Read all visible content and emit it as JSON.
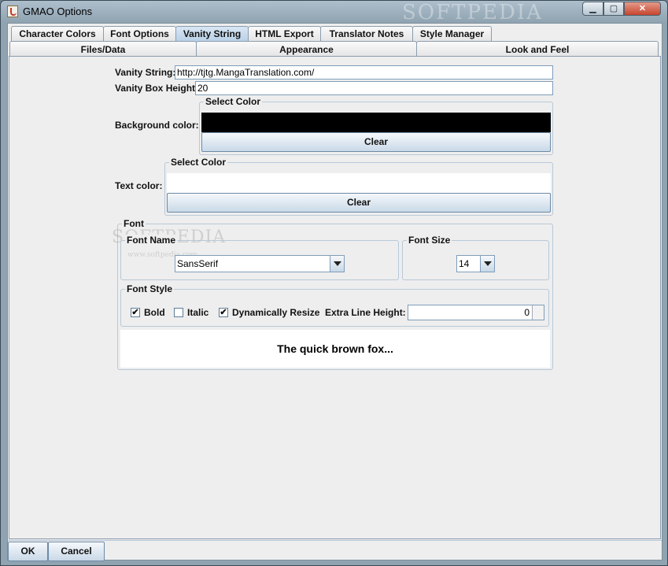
{
  "window": {
    "title": "GMAO Options",
    "watermark": "SOFTPEDIA"
  },
  "window_buttons": {
    "minimize": "▁",
    "maximize": "▢",
    "close": "✕"
  },
  "tabs_row1": [
    "Character Colors",
    "Font Options",
    "Vanity String",
    "HTML Export",
    "Translator Notes",
    "Style Manager"
  ],
  "tabs_row2": [
    "Files/Data",
    "Appearance",
    "Look and Feel"
  ],
  "vanity": {
    "string_label": "Vanity String:",
    "string_value": "http://tjtg.MangaTranslation.com/",
    "height_label": "Vanity Box Height:",
    "height_value": "20"
  },
  "background_color": {
    "label": "Background color:",
    "group_title": "Select Color",
    "swatch_color": "#000000",
    "clear_label": "Clear"
  },
  "text_color": {
    "label": "Text color:",
    "group_title": "Select Color",
    "swatch_color": "#ffffff",
    "clear_label": "Clear"
  },
  "font": {
    "group_title": "Font",
    "name_title": "Font Name",
    "name_value": "SansSerif",
    "size_title": "Font Size",
    "size_value": "14",
    "style_title": "Font Style",
    "bold_label": "Bold",
    "bold_checked": "✔",
    "italic_label": "Italic",
    "italic_checked": "",
    "resize_label": "Dynamically Resize",
    "resize_checked": "✔",
    "line_height_label": "Extra Line Height:",
    "line_height_value": "0",
    "preview_text": "The quick brown fox...",
    "inner_watermark": "SOFTPEDIA",
    "inner_watermark_url": "www.softpedia.com"
  },
  "footer": {
    "ok_label": "OK",
    "cancel_label": "Cancel"
  }
}
